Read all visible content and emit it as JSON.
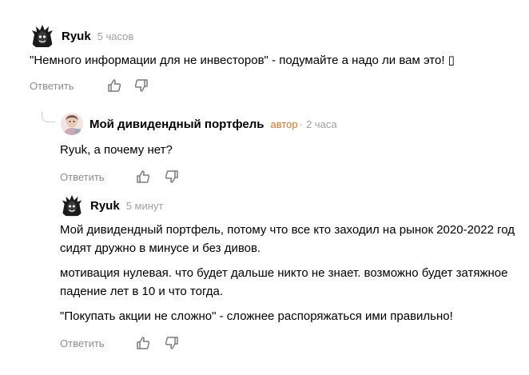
{
  "comments": [
    {
      "author": "Ryuk",
      "badge": "",
      "time": "5 часов",
      "paragraphs": [
        "\"Немного информации для не инвесторов\" - подумайте а надо ли вам это! ▯"
      ],
      "reply_label": "Ответить"
    },
    {
      "author": "Мой дивидендный портфель",
      "badge": "автор",
      "dot": "·",
      "time": "2 часа",
      "paragraphs": [
        "Ryuk, а почему нет?"
      ],
      "reply_label": "Ответить"
    },
    {
      "author": "Ryuk",
      "badge": "",
      "time": "5 минут",
      "paragraphs": [
        "Мой дивидендный портфель, потому что все кто заходил на рынок 2020-2022 год сидят дружно в минусе и без дивов.",
        "мотивация нулевая. что будет дальше никто не знает. возможно будет затяжное падение лет в 10 и что тогда.",
        "\"Покупать акции не сложно\" - сложнее распоряжаться ими правильно!"
      ],
      "reply_label": "Ответить"
    }
  ],
  "icons": {
    "like": "thumbs-up-icon",
    "dislike": "thumbs-down-icon",
    "avatar_ryuk": "ryuk-avatar",
    "avatar_portfolio": "portfolio-avatar"
  },
  "colors": {
    "author_badge": "#e0742a",
    "muted": "#a0a0a0",
    "reply": "#8c8c8c"
  }
}
